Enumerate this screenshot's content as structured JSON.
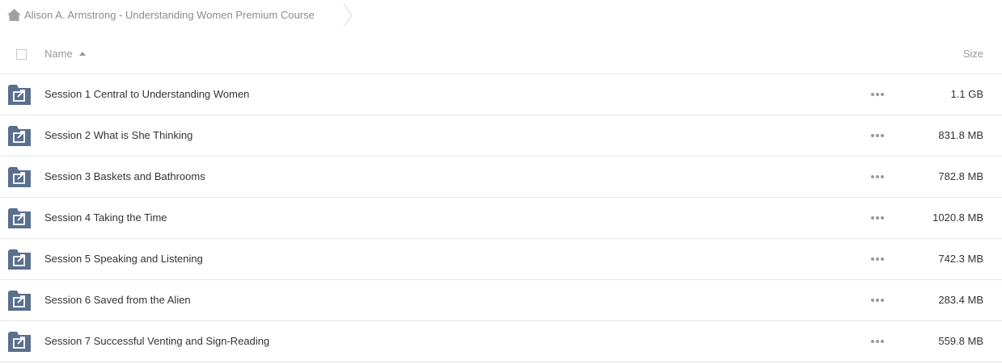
{
  "breadcrumb": {
    "home_icon": "home-icon",
    "current": "Alison A. Armstrong - Understanding Women Premium Course"
  },
  "header": {
    "name_label": "Name",
    "size_label": "Size",
    "sort": "ascending"
  },
  "colors": {
    "folder": "#5a6f8e",
    "muted_text": "#999999",
    "text": "#333333",
    "divider": "#e6e6e6"
  },
  "files": [
    {
      "name": "Session 1 Central to Understanding Women",
      "size": "1.1 GB",
      "icon": "shared-folder-icon"
    },
    {
      "name": "Session 2 What is She Thinking",
      "size": "831.8 MB",
      "icon": "shared-folder-icon"
    },
    {
      "name": "Session 3 Baskets and Bathrooms",
      "size": "782.8 MB",
      "icon": "shared-folder-icon"
    },
    {
      "name": "Session 4 Taking the Time",
      "size": "1020.8 MB",
      "icon": "shared-folder-icon"
    },
    {
      "name": "Session 5 Speaking and Listening",
      "size": "742.3 MB",
      "icon": "shared-folder-icon"
    },
    {
      "name": "Session 6 Saved from the Alien",
      "size": "283.4 MB",
      "icon": "shared-folder-icon"
    },
    {
      "name": "Session 7 Successful Venting and Sign-Reading",
      "size": "559.8 MB",
      "icon": "shared-folder-icon"
    }
  ]
}
